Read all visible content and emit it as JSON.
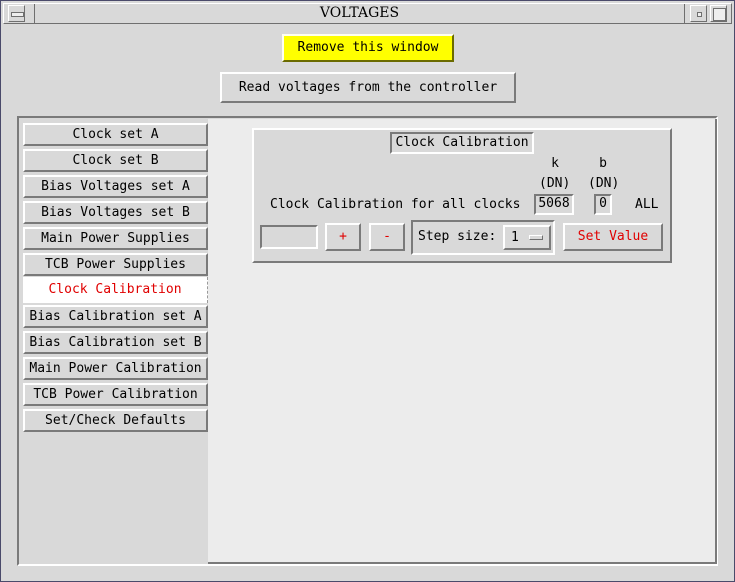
{
  "window": {
    "title": "VOLTAGES"
  },
  "buttons": {
    "remove": "Remove this window",
    "read": "Read voltages from the controller"
  },
  "tabs": [
    {
      "label": "Clock set A",
      "active": false
    },
    {
      "label": "Clock set B",
      "active": false
    },
    {
      "label": "Bias Voltages set A",
      "active": false
    },
    {
      "label": "Bias Voltages set B",
      "active": false
    },
    {
      "label": "Main Power Supplies",
      "active": false
    },
    {
      "label": "TCB Power Supplies",
      "active": false
    },
    {
      "label": "Clock Calibration",
      "active": true
    },
    {
      "label": "Bias Calibration set A",
      "active": false
    },
    {
      "label": "Bias Calibration set B",
      "active": false
    },
    {
      "label": "Main Power Calibration",
      "active": false
    },
    {
      "label": "TCB Power Calibration",
      "active": false
    },
    {
      "label": "Set/Check Defaults",
      "active": false
    }
  ],
  "calibration": {
    "title": "Clock Calibration",
    "k_header": "k",
    "b_header": "b",
    "k_unit": "(DN)",
    "b_unit": "(DN)",
    "row_label": "Clock Calibration for all clocks",
    "k_value": "5068",
    "b_value": "0",
    "all_label": "ALL",
    "entry_value": "",
    "plus_label": "+",
    "minus_label": "-",
    "step_label": "Step size:",
    "step_value": "1",
    "set_value_label": "Set Value"
  },
  "colors": {
    "background": "#d9d9d9",
    "panel": "#ececec",
    "highlight_button": "#ffff00",
    "active_text": "#e00000"
  }
}
